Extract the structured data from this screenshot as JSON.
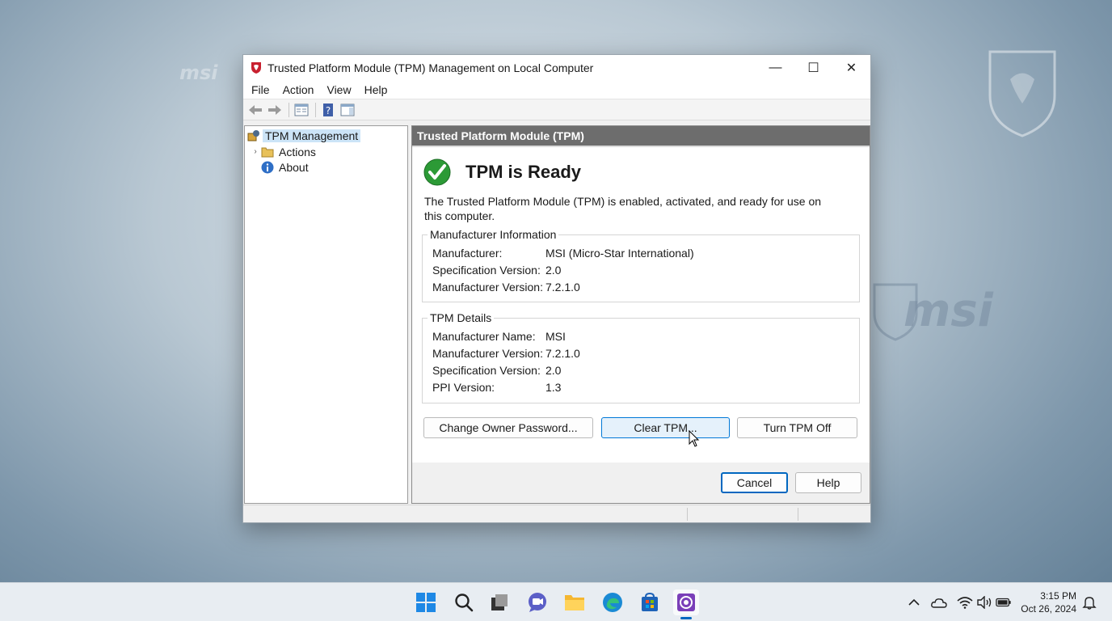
{
  "wallpaper": {
    "brand_left": "msi",
    "brand_right": "msi"
  },
  "window": {
    "title": "Trusted Platform Module (TPM) Management on Local Computer",
    "controls": {
      "minimize": "—",
      "maximize": "☐",
      "close": "✕"
    }
  },
  "menu": [
    "File",
    "Action",
    "View",
    "Help"
  ],
  "tree": {
    "root": "TPM Management",
    "items": [
      {
        "label": "Actions"
      },
      {
        "label": "About"
      }
    ]
  },
  "pane": {
    "header": "Trusted Platform Module (TPM)",
    "status_title": "TPM is Ready",
    "status_desc": "The Trusted Platform Module (TPM) is enabled, activated, and ready for use on this computer.",
    "manufacturer_info": {
      "legend": "Manufacturer Information",
      "rows": [
        {
          "k": "Manufacturer:",
          "v": "MSI (Micro-Star International)"
        },
        {
          "k": "Specification Version:",
          "v": "2.0"
        },
        {
          "k": "Manufacturer Version:",
          "v": "7.2.1.0"
        }
      ]
    },
    "tpm_details": {
      "legend": "TPM Details",
      "rows": [
        {
          "k": "Manufacturer Name:",
          "v": "MSI"
        },
        {
          "k": "Manufacturer Version:",
          "v": "7.2.1.0"
        },
        {
          "k": "Specification Version:",
          "v": "2.0"
        },
        {
          "k": "PPI Version:",
          "v": "1.3"
        }
      ]
    },
    "buttons": {
      "change_owner": "Change Owner Password...",
      "clear": "Clear TPM...",
      "turn_off": "Turn TPM Off",
      "cancel": "Cancel",
      "help": "Help"
    }
  },
  "taskbar": {
    "apps": [
      "start-icon",
      "search-icon",
      "task-view-icon",
      "chat-icon",
      "file-explorer-icon",
      "edge-icon",
      "store-icon",
      "tpm-app-icon"
    ],
    "tray": [
      "chevron-up-icon",
      "onedrive-icon",
      "wifi-icon",
      "volume-icon",
      "battery-icon"
    ],
    "time": "3:15 PM",
    "date": "Oct 26, 2024"
  },
  "colors": {
    "accent": "#0067c0",
    "pane_header": "#6d6d6d",
    "selection": "#cce4f7"
  }
}
